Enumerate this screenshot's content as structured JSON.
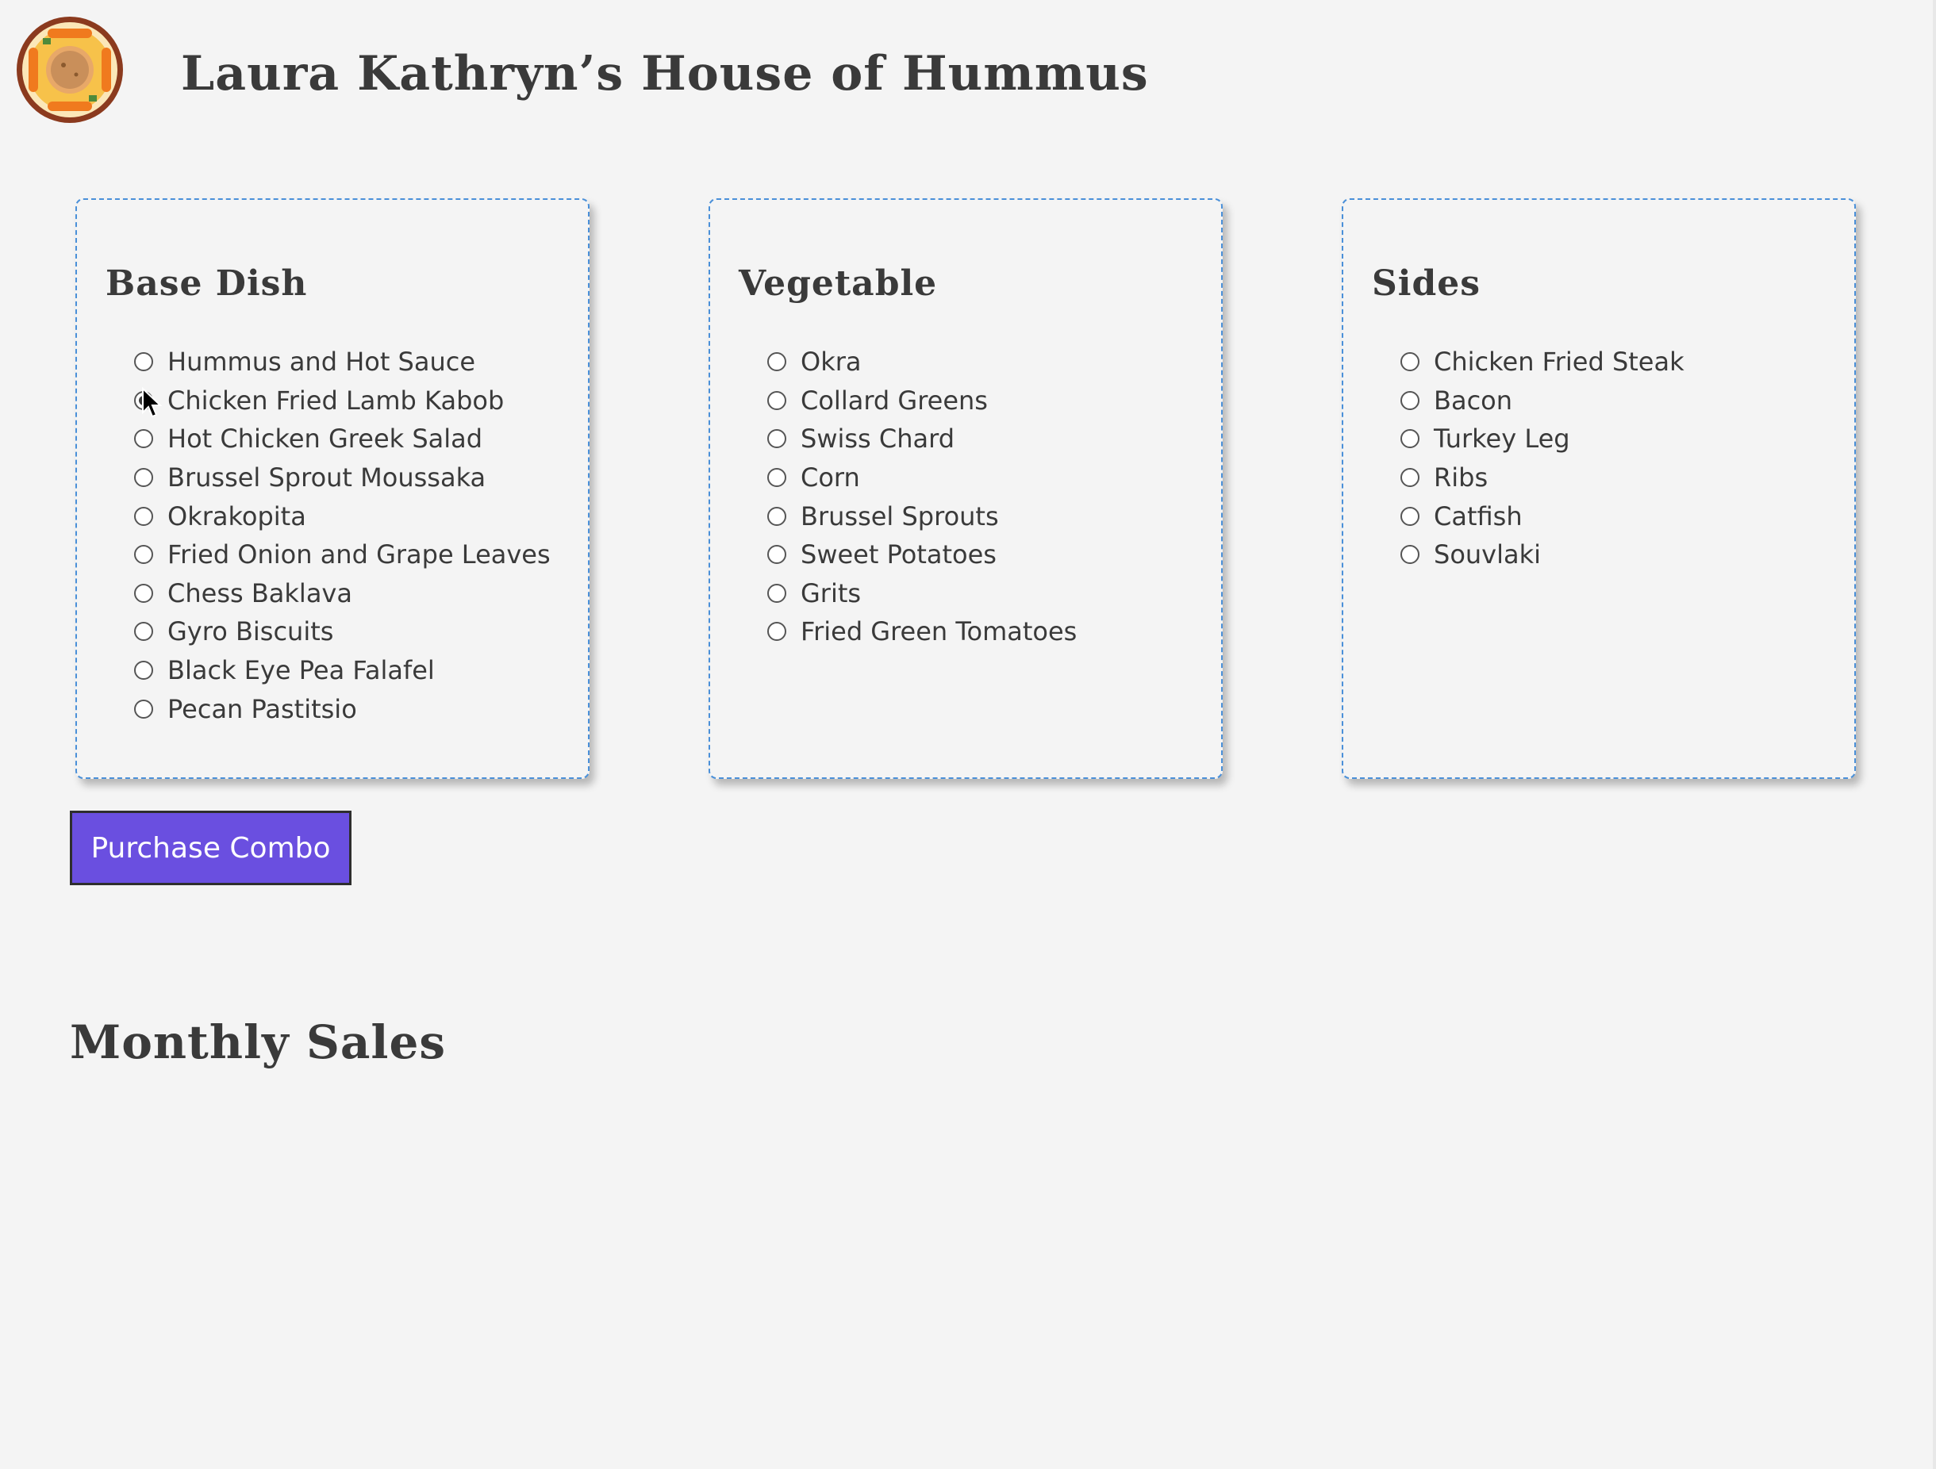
{
  "header": {
    "title": "Laura Kathryn’s House of Hummus",
    "logo_icon": "hummus-plate-icon"
  },
  "panels": [
    {
      "title": "Base Dish",
      "options": [
        {
          "label": "Hummus and Hot Sauce",
          "checked": false
        },
        {
          "label": "Chicken Fried Lamb Kabob",
          "checked": true
        },
        {
          "label": "Hot Chicken Greek Salad",
          "checked": false
        },
        {
          "label": "Brussel Sprout Moussaka",
          "checked": false
        },
        {
          "label": "Okrakopita",
          "checked": false
        },
        {
          "label": "Fried Onion and Grape Leaves",
          "checked": false
        },
        {
          "label": "Chess Baklava",
          "checked": false
        },
        {
          "label": "Gyro Biscuits",
          "checked": false
        },
        {
          "label": "Black Eye Pea Falafel",
          "checked": false
        },
        {
          "label": "Pecan Pastitsio",
          "checked": false
        }
      ]
    },
    {
      "title": "Vegetable",
      "options": [
        {
          "label": "Okra",
          "checked": false
        },
        {
          "label": "Collard Greens",
          "checked": false
        },
        {
          "label": "Swiss Chard",
          "checked": false
        },
        {
          "label": "Corn",
          "checked": false
        },
        {
          "label": "Brussel Sprouts",
          "checked": false
        },
        {
          "label": "Sweet Potatoes",
          "checked": false
        },
        {
          "label": "Grits",
          "checked": false
        },
        {
          "label": "Fried Green Tomatoes",
          "checked": false
        }
      ]
    },
    {
      "title": "Sides",
      "options": [
        {
          "label": "Chicken Fried Steak",
          "checked": false
        },
        {
          "label": "Bacon",
          "checked": false
        },
        {
          "label": "Turkey Leg",
          "checked": false
        },
        {
          "label": "Ribs",
          "checked": false
        },
        {
          "label": "Catfish",
          "checked": false
        },
        {
          "label": "Souvlaki",
          "checked": false
        }
      ]
    }
  ],
  "purchase_button": {
    "label": "Purchase Combo"
  },
  "sales": {
    "title": "Monthly Sales"
  },
  "colors": {
    "background": "#f4f4f4",
    "text": "#3a3a3a",
    "panel_border": "#4a90d9",
    "button": "#6a4fe0",
    "button_text": "#ffffff",
    "logo_ring": "#8b3a1e",
    "logo_plate": "#f7c24a",
    "logo_carrot": "#f07a1e"
  }
}
